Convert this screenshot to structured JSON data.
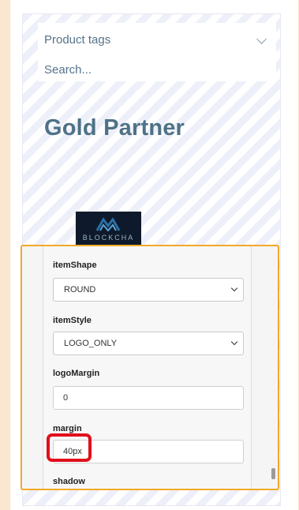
{
  "sidebar": {
    "product_tags_label": "Product tags",
    "search_placeholder": "Search...",
    "heading": "Gold Partner",
    "logo_text": "BLOCKCHA"
  },
  "editor": {
    "item_shape": {
      "label": "itemShape",
      "value": "ROUND"
    },
    "item_style": {
      "label": "itemStyle",
      "value": "LOGO_ONLY"
    },
    "logo_margin": {
      "label": "logoMargin",
      "value": "0"
    },
    "margin": {
      "label": "margin",
      "value": "40px"
    },
    "shadow": {
      "label": "shadow"
    }
  },
  "colors": {
    "background": "#fbe6cf",
    "heading": "#4e7287",
    "editor_border": "#f3a929",
    "highlight": "#e10f1b"
  },
  "icons": [
    "chevron-down-icon",
    "caret-down-icon",
    "mountain-logo-icon"
  ]
}
